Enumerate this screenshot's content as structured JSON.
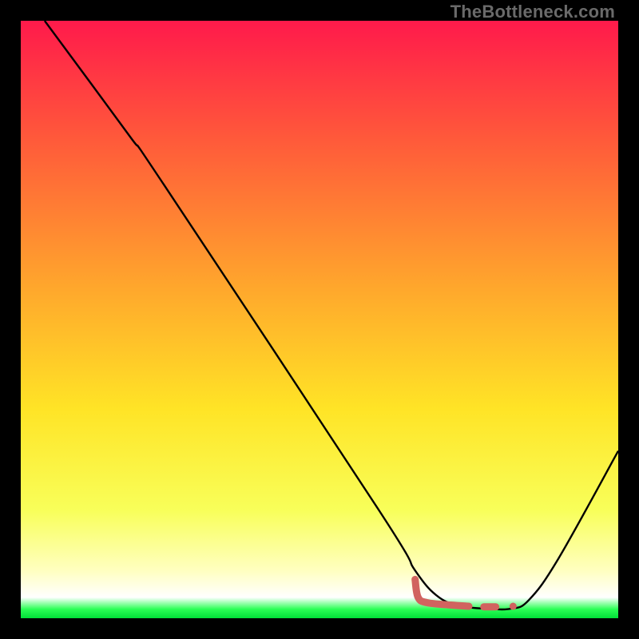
{
  "watermark": "TheBottleneck.com",
  "chart_data": {
    "type": "line",
    "title": "",
    "xlabel": "",
    "ylabel": "",
    "xlim": [
      0,
      100
    ],
    "ylim": [
      0,
      100
    ],
    "grid": false,
    "legend": false,
    "gradient_stops": [
      {
        "offset": 0.0,
        "color": "#ff1a4b"
      },
      {
        "offset": 0.2,
        "color": "#ff5a3a"
      },
      {
        "offset": 0.45,
        "color": "#ffa82c"
      },
      {
        "offset": 0.65,
        "color": "#ffe426"
      },
      {
        "offset": 0.82,
        "color": "#f8ff5a"
      },
      {
        "offset": 0.92,
        "color": "#ffffc0"
      },
      {
        "offset": 0.965,
        "color": "#ffffff"
      },
      {
        "offset": 0.985,
        "color": "#2bff55"
      },
      {
        "offset": 1.0,
        "color": "#00e038"
      }
    ],
    "series": [
      {
        "name": "bottleneck-curve",
        "stroke": "#000000",
        "stroke_width": 2.4,
        "points": [
          {
            "x": 4.0,
            "y": 100.0
          },
          {
            "x": 18.0,
            "y": 81.0
          },
          {
            "x": 24.0,
            "y": 72.5
          },
          {
            "x": 60.0,
            "y": 18.0
          },
          {
            "x": 66.0,
            "y": 8.0
          },
          {
            "x": 70.0,
            "y": 3.5
          },
          {
            "x": 74.0,
            "y": 2.0
          },
          {
            "x": 78.0,
            "y": 1.6
          },
          {
            "x": 82.0,
            "y": 1.6
          },
          {
            "x": 85.0,
            "y": 3.0
          },
          {
            "x": 90.0,
            "y": 10.0
          },
          {
            "x": 100.0,
            "y": 28.0
          }
        ]
      },
      {
        "name": "optimal-markers",
        "stroke": "#d1635f",
        "stroke_width": 9,
        "linecap": "round",
        "points": [
          {
            "x": 66.0,
            "y": 6.5
          },
          {
            "x": 66.5,
            "y": 3.5
          },
          {
            "x": 68.0,
            "y": 2.6
          },
          {
            "x": 72.0,
            "y": 2.2
          },
          {
            "x": 75.0,
            "y": 2.0
          }
        ],
        "extra_segments": [
          [
            {
              "x": 77.5,
              "y": 1.9
            },
            {
              "x": 79.5,
              "y": 1.9
            }
          ]
        ],
        "dots": [
          {
            "x": 82.4,
            "y": 2.0
          }
        ]
      }
    ]
  }
}
